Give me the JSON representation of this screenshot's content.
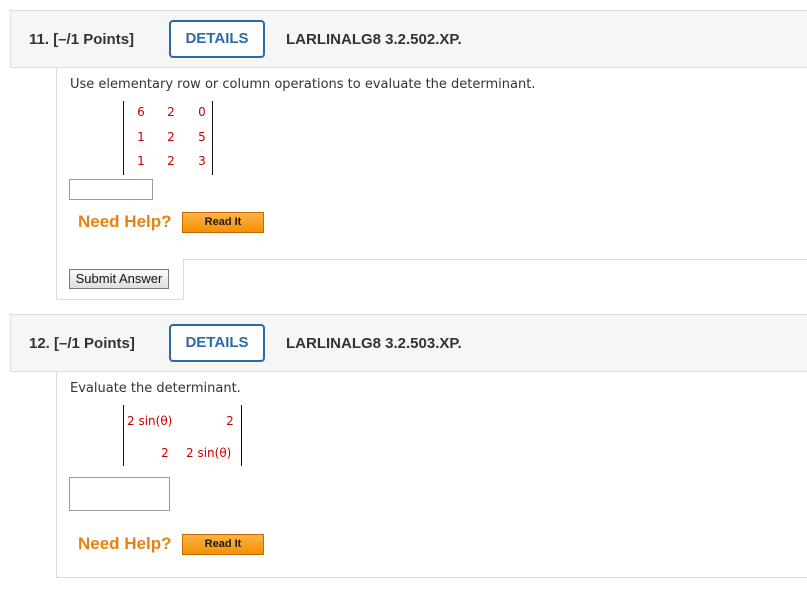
{
  "questions": [
    {
      "number": "11. [–/1 Points]",
      "details": "DETAILS",
      "code": "LARLINALG8 3.2.502.XP.",
      "instruction": "Use elementary row or column operations to evaluate the determinant.",
      "matrix": [
        [
          "6",
          "2",
          "0"
        ],
        [
          "1",
          "2",
          "5"
        ],
        [
          "1",
          "2",
          "3"
        ]
      ],
      "answer_value": "",
      "need_help": "Need Help?",
      "read_it": "Read It",
      "submit": "Submit Answer"
    },
    {
      "number": "12. [–/1 Points]",
      "details": "DETAILS",
      "code": "LARLINALG8 3.2.503.XP.",
      "instruction": "Evaluate the determinant.",
      "matrix": [
        [
          "2 sin(θ)",
          "2"
        ],
        [
          "2",
          "2 sin(θ)"
        ]
      ],
      "answer_value": "",
      "need_help": "Need Help?",
      "read_it": "Read It"
    }
  ],
  "colors": {
    "accent_blue": "#2c6aa6",
    "help_orange": "#e8820e",
    "matrix_red": "#cc0000",
    "header_bg": "#f6f6f6"
  }
}
